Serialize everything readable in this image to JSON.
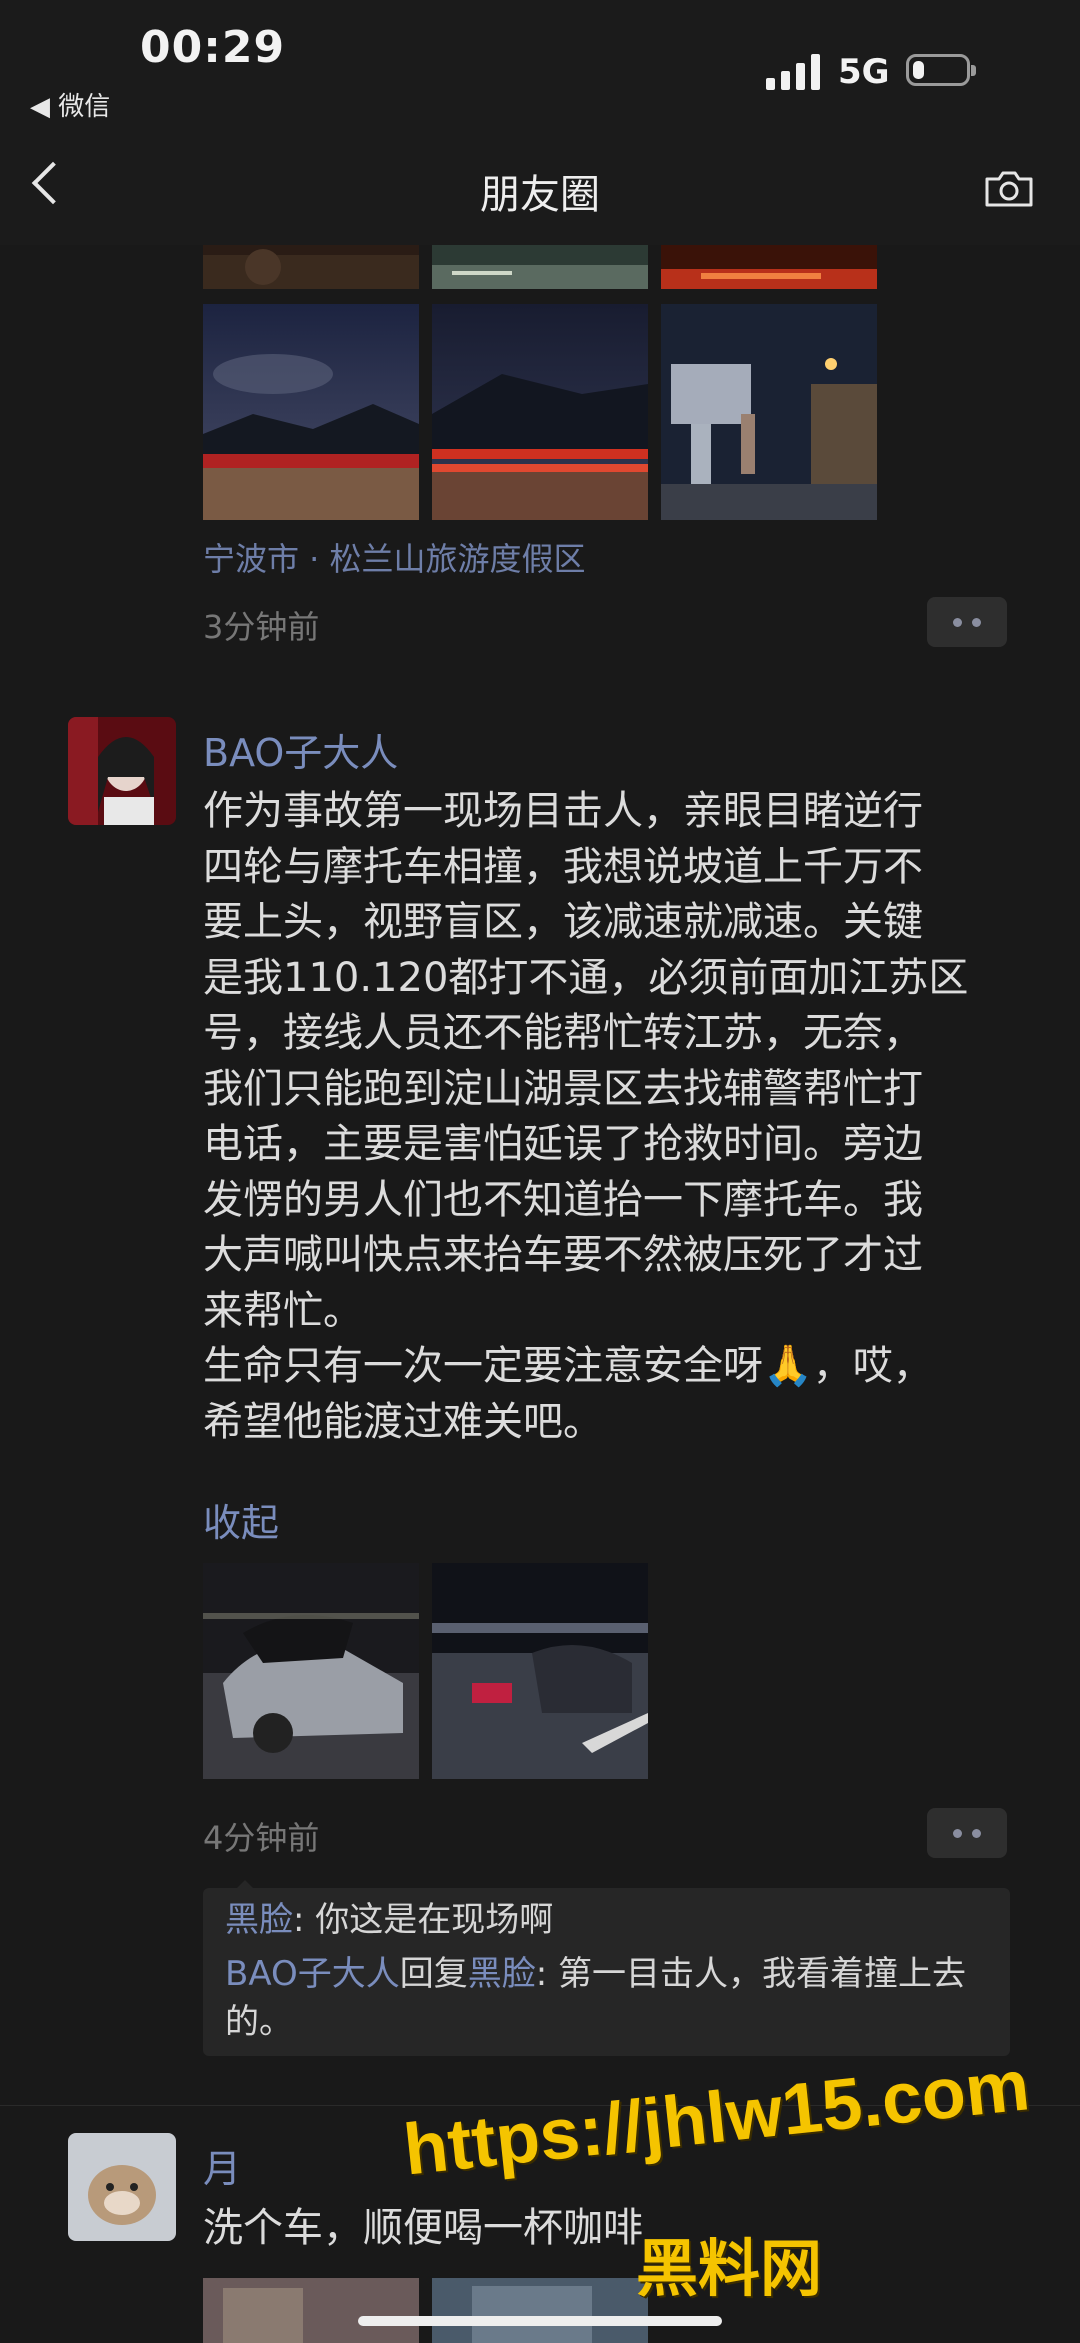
{
  "status_bar": {
    "time": "00:29",
    "back_app": "◀ 微信",
    "network": "5G",
    "battery_level": 0.22
  },
  "nav": {
    "title": "朋友圈"
  },
  "post1": {
    "location": "宁波市 · 松兰山旅游度假区",
    "time": "3分钟前"
  },
  "post2": {
    "author": "BAO子大人",
    "text": "作为事故第一现场目击人，亲眼目睹逆行\n四轮与摩托车相撞，我想说坡道上千万不\n要上头，视野盲区，该减速就减速。关键\n是我110.120都打不通，必须前面加江苏区\n号，接线人员还不能帮忙转江苏，无奈，\n我们只能跑到淀山湖景区去找辅警帮忙打\n电话，主要是害怕延误了抢救时间。旁边\n发愣的男人们也不知道抬一下摩托车。我\n大声喊叫快点来抬车要不然被压死了才过\n来帮忙。\n生命只有一次一定要注意安全呀🙏，哎，\n希望他能渡过难关吧。",
    "collapse": "收起",
    "time": "4分钟前",
    "comments": [
      {
        "name": "黑脸",
        "sep": ": ",
        "text": "你这是在现场啊"
      },
      {
        "name": "BAO子大人",
        "reply": "回复",
        "target": "黑脸",
        "sep": ": ",
        "text": "第一目击人，我看着撞上去的。"
      }
    ]
  },
  "post3": {
    "author": "月",
    "text": "洗个车，顺便喝一杯咖啡"
  },
  "watermark": {
    "url": "https://jhlw15.com",
    "name": "黑料网"
  }
}
